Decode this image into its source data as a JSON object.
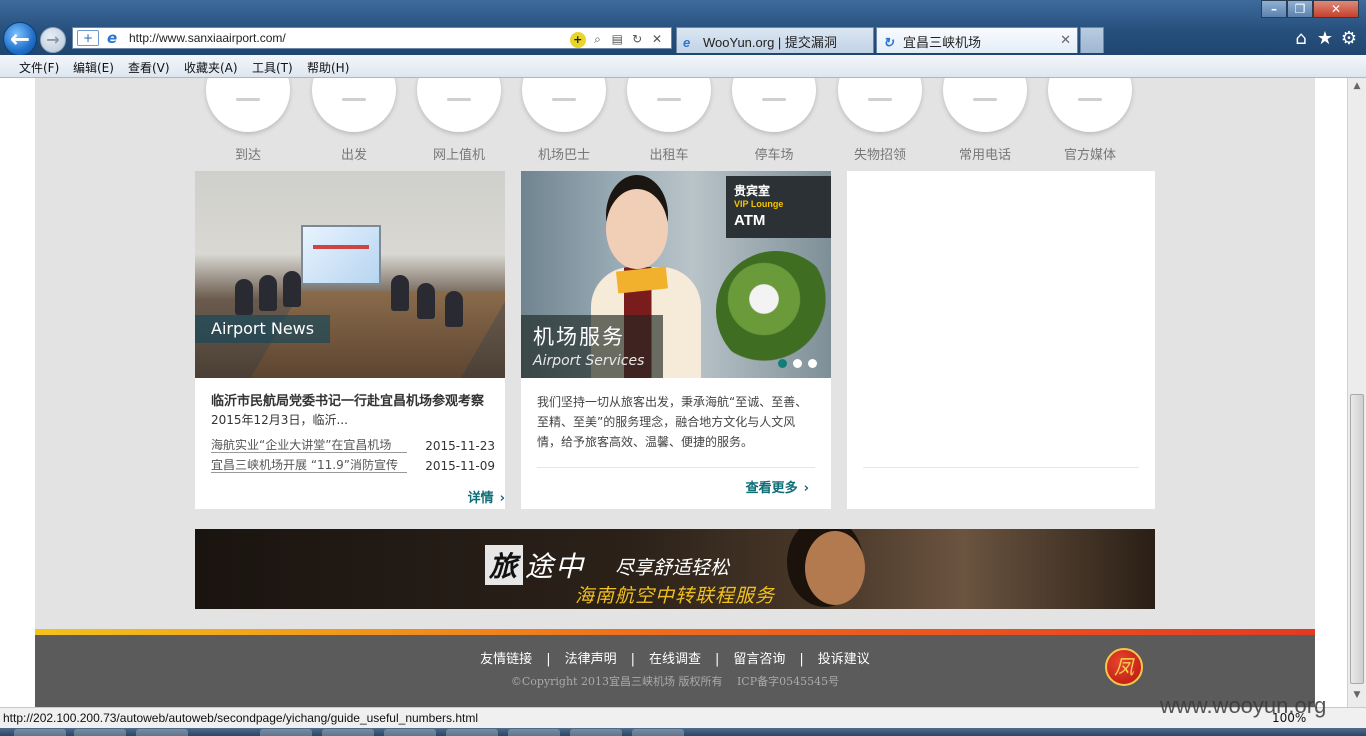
{
  "browser": {
    "url": "http://www.sanxiaairport.com/",
    "tabs": [
      {
        "label": "WooYun.org | 提交漏洞",
        "active": false
      },
      {
        "label": "宜昌三峡机场",
        "active": true
      }
    ],
    "menu": [
      "文件(F)",
      "编辑(E)",
      "查看(V)",
      "收藏夹(A)",
      "工具(T)",
      "帮助(H)"
    ],
    "status_url": "http://202.100.200.73/autoweb/autoweb/secondpage/yichang/guide_useful_numbers.html",
    "zoom": "100%",
    "watermark": "www.wooyun.org"
  },
  "services": [
    "到达",
    "出发",
    "网上值机",
    "机场巴士",
    "出租车",
    "停车场",
    "失物招领",
    "常用电话",
    "官方媒体"
  ],
  "news": {
    "tag": "Airport News",
    "headline": "临沂市民航局党委书记一行赴宜昌机场参观考察",
    "summary": "2015年12月3日，临沂...",
    "items": [
      {
        "title": "海航实业“企业大讲堂”在宜昌机场",
        "date": "2015-11-23"
      },
      {
        "title": "宜昌三峡机场开展 “11.9”消防宣传",
        "date": "2015-11-09"
      }
    ],
    "more": "详情"
  },
  "service": {
    "title_cn": "机场服务",
    "title_en": "Airport Services",
    "sign_vip": "贵宾室",
    "sign_vip_en": "VIP Lounge",
    "sign_atm": "ATM",
    "description": "我们坚持一切从旅客出发，秉承海航“至诚、至善、至精、至美”的服务理念，融合地方文化与人文风情，给予旅客高效、温馨、便捷的服务。",
    "more": "查看更多",
    "slides_total": 3,
    "slide_active": 1
  },
  "banner": {
    "line1_box": "旅",
    "line1_rest": "途中",
    "line1_tail": "尽享舒适轻松",
    "line2": "海南航空中转联程服务"
  },
  "footer": {
    "links": [
      "友情链接",
      "法律声明",
      "在线调查",
      "留言咨询",
      "投诉建议"
    ],
    "separator": "|",
    "copyright": "©Copyright 2013宜昌三峡机场 版权所有　 ICP备字0545545号",
    "logo_char": "凤"
  },
  "colors": {
    "accent_teal": "#127d78",
    "page_bg": "#e3e3e3",
    "footer_bg": "#5b5b5b",
    "footer_stripe_start": "#f3c21c",
    "footer_stripe_end": "#e23a22"
  }
}
